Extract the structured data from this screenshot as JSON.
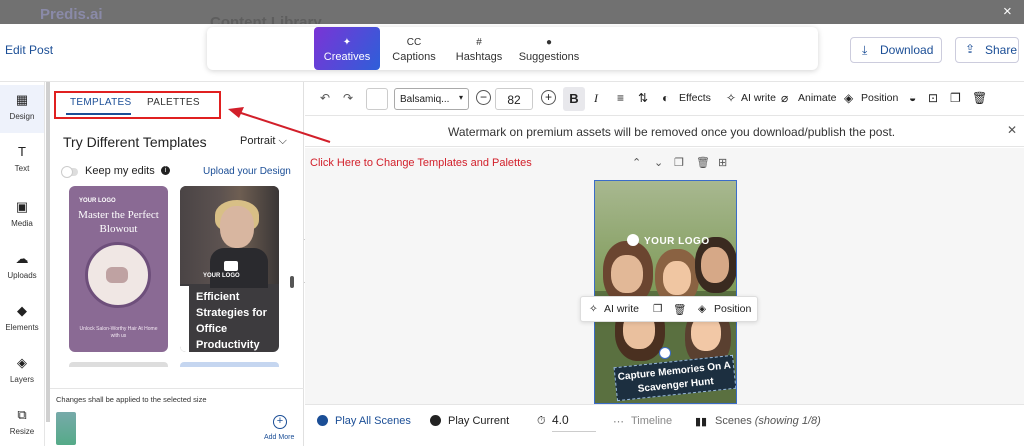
{
  "background": {
    "logo": "Predis.ai",
    "title": "Content Library",
    "close": "×"
  },
  "header": {
    "edit_post": "Edit Post",
    "tabs": [
      {
        "label": "Creatives",
        "icon": "magic-wand-icon",
        "glyph": "✦"
      },
      {
        "label": "Captions",
        "icon": "captions-icon",
        "glyph": "CC"
      },
      {
        "label": "Hashtags",
        "icon": "hashtag-icon",
        "glyph": "#"
      },
      {
        "label": "Suggestions",
        "icon": "lightbulb-icon",
        "glyph": "●"
      }
    ],
    "download": "Download",
    "share": "Share"
  },
  "sidebar": {
    "items": [
      {
        "label": "Design",
        "icon": "design-icon",
        "glyph": "▦"
      },
      {
        "label": "Text",
        "icon": "text-icon",
        "glyph": "T"
      },
      {
        "label": "Media",
        "icon": "media-icon",
        "glyph": "▣"
      },
      {
        "label": "Uploads",
        "icon": "upload-icon",
        "glyph": "☁"
      },
      {
        "label": "Elements",
        "icon": "elements-icon",
        "glyph": "◆"
      },
      {
        "label": "Layers",
        "icon": "layers-icon",
        "glyph": "◈"
      },
      {
        "label": "Resize",
        "icon": "resize-icon",
        "glyph": "⧉"
      }
    ]
  },
  "panel": {
    "tab_templates": "TEMPLATES",
    "tab_palettes": "PALETTES",
    "title": "Try Different Templates",
    "orientation": "Portrait",
    "keep_edits": "Keep my edits",
    "info": "i",
    "upload_design": "Upload your Design",
    "card1": {
      "logo": "YOUR LOGO",
      "headline": "Master the Perfect Blowout",
      "sub": "Unlock Salon-Worthy Hair At Home with us"
    },
    "card2": {
      "logo": "YOUR LOGO",
      "headline": "Efficient Strategies for Office Productivity"
    },
    "changes_note": "Changes shall be applied to the selected size",
    "add_more": "Add More"
  },
  "toolbar": {
    "font": "Balsamiq...",
    "font_size": "82",
    "bold": "B",
    "italic": "I",
    "effects": "Effects",
    "ai_write": "AI write",
    "animate": "Animate",
    "position": "Position"
  },
  "watermark": "Watermark on premium assets will be removed once you download/publish the post.",
  "annotation": "Click Here to Change Templates and Palettes",
  "canvas": {
    "design_logo": "YOUR LOGO",
    "banner": "Capture Memories On A Scavenger Hunt",
    "float_ai_write": "AI write",
    "float_position": "Position"
  },
  "bottom": {
    "play_all": "Play All Scenes",
    "play_current": "Play Current",
    "duration": "4.0",
    "timeline": "Timeline",
    "scenes_label": "Scenes",
    "scenes_count": "(showing 1/8)"
  },
  "colors": {
    "primary": "#1b4e96",
    "accent_red": "#e02020",
    "gradient_start": "#7a34d6",
    "gradient_end": "#2e5fd9"
  }
}
